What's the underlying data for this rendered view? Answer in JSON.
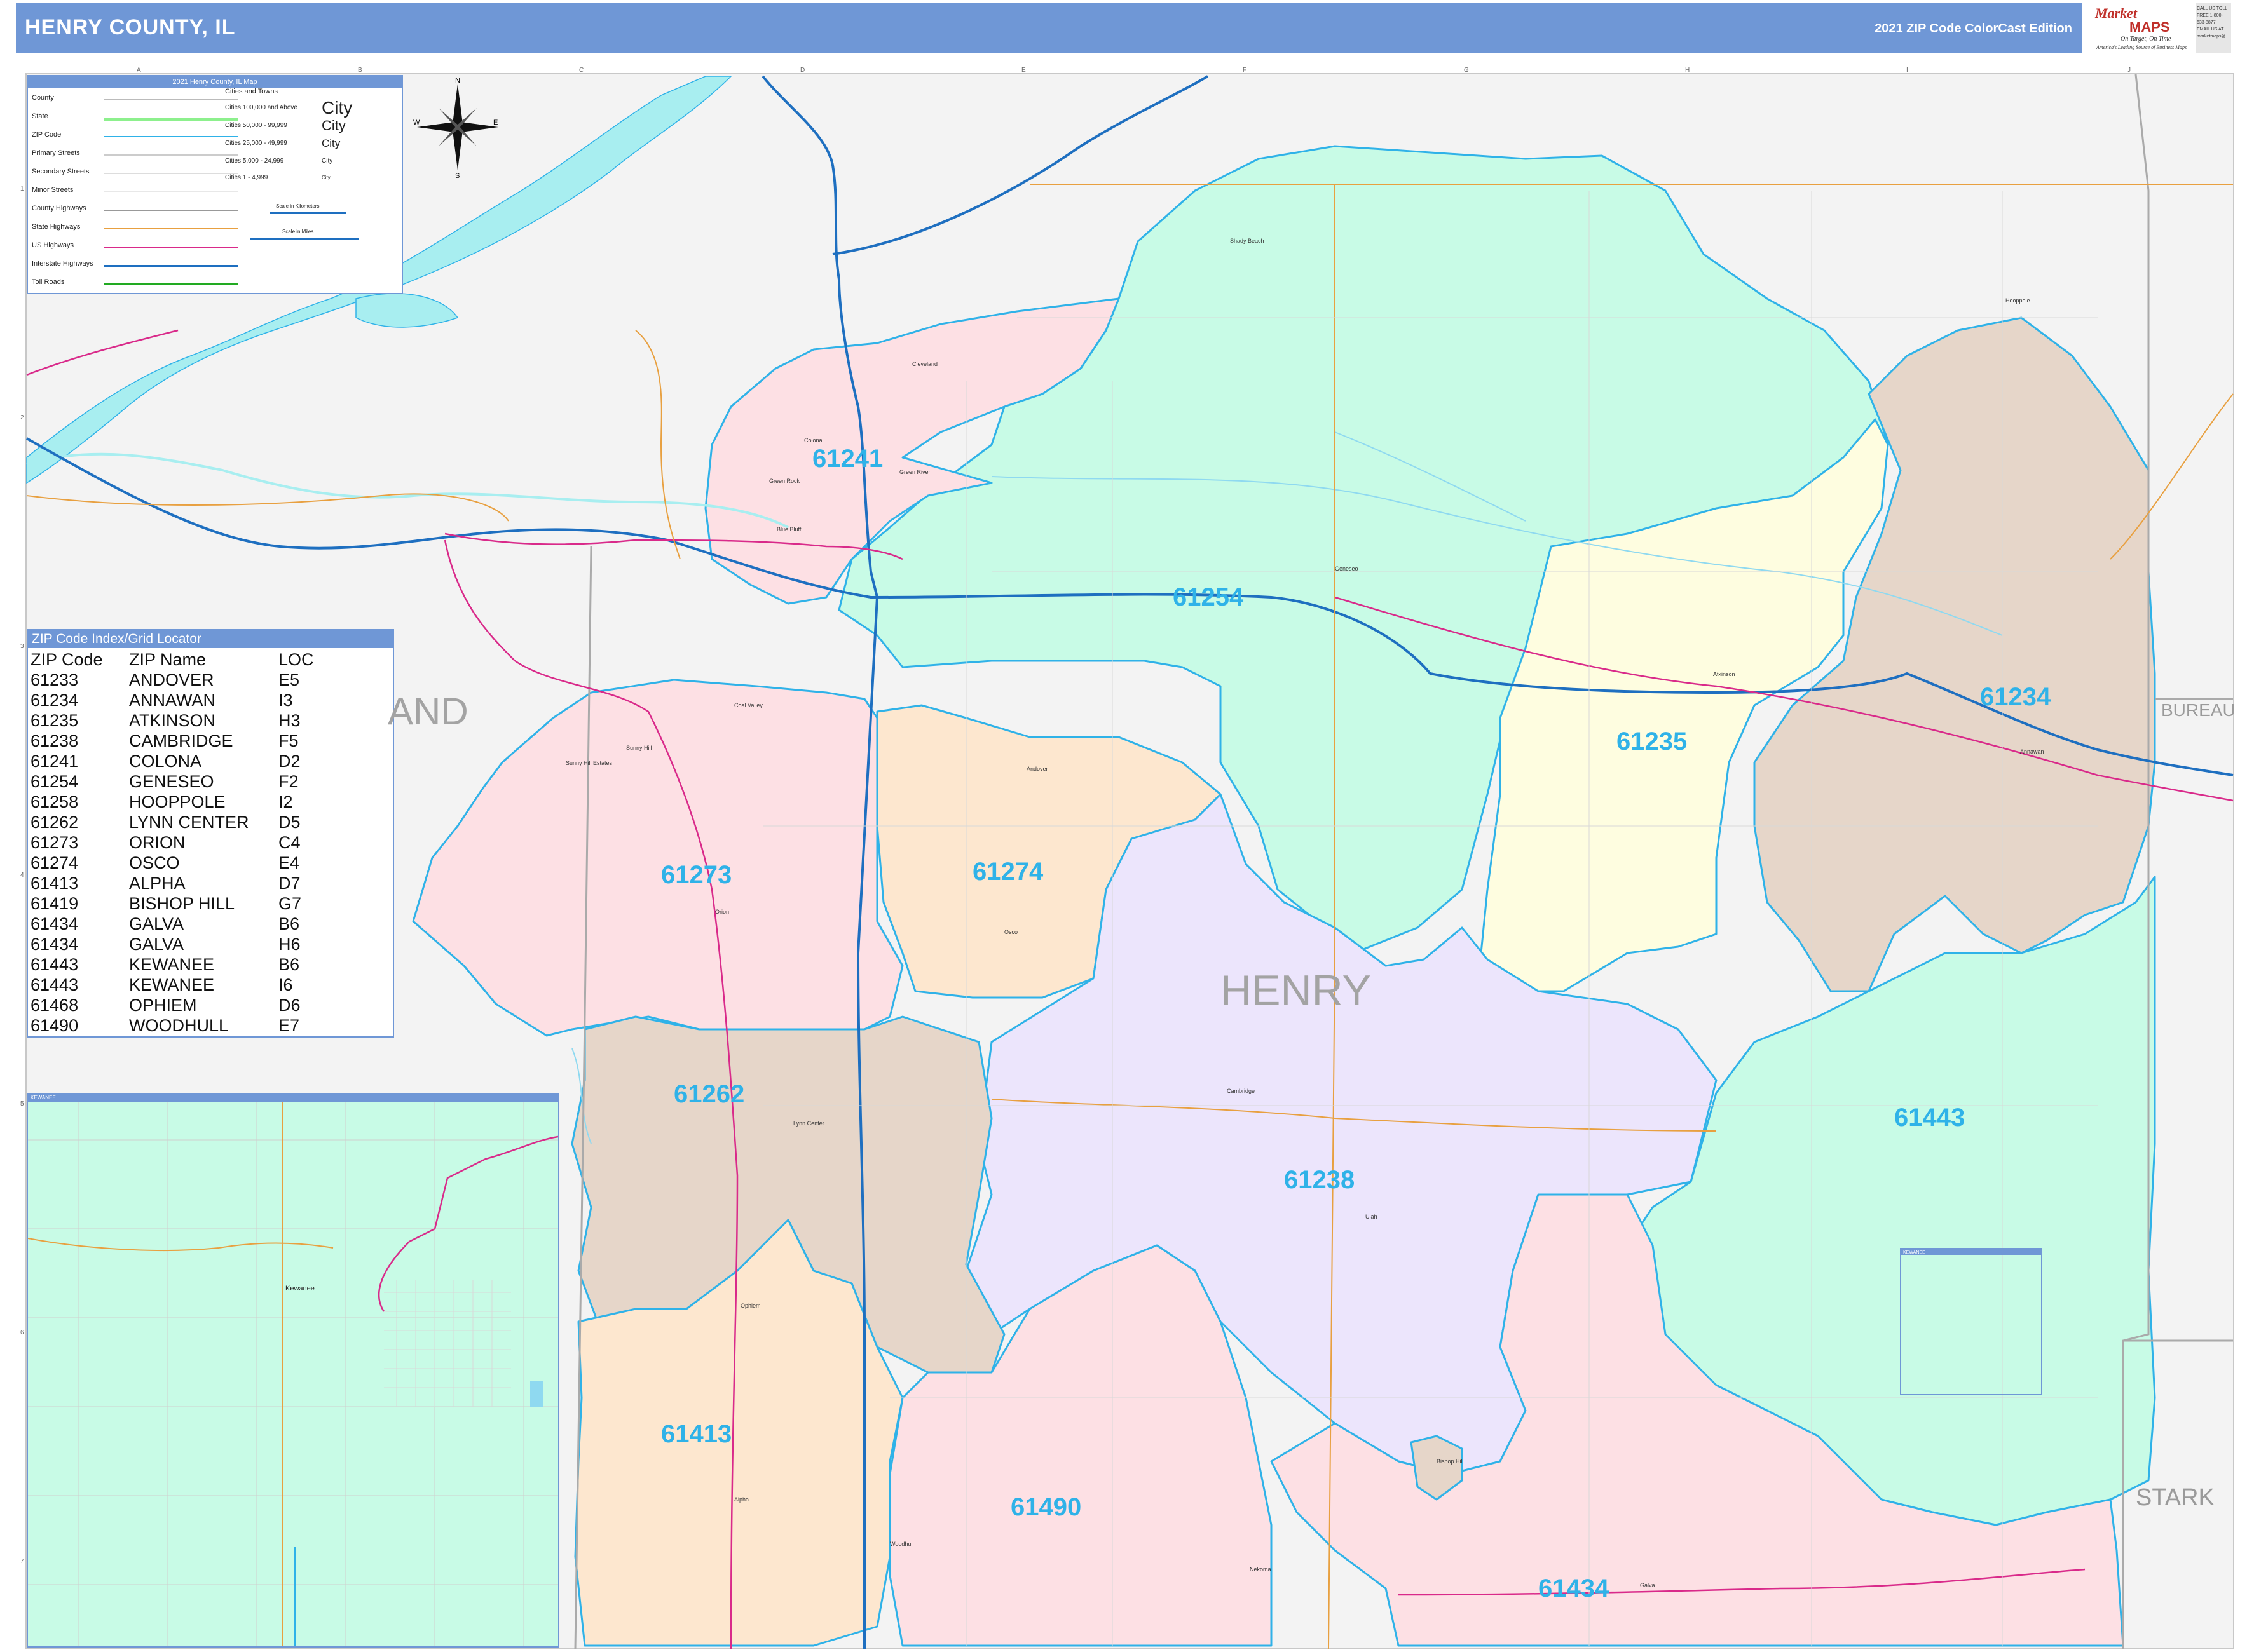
{
  "header": {
    "title": "HENRY COUNTY, IL",
    "edition": "2021 ZIP Code ColorCast Edition",
    "logo_brand": "Market",
    "logo_maps": "MAPS",
    "logo_tagline": "On Target, On Time",
    "logo_subtitle": "America's Leading Source of Business Maps",
    "logo_contact": "CALL US TOLL FREE 1-800-633-8877 EMAIL US AT marketmaps@..."
  },
  "legend": {
    "title": "2021 Henry County, IL Map",
    "line_items": [
      {
        "label": "County",
        "color": "#bbbbbb"
      },
      {
        "label": "State",
        "color": "#8df08d"
      },
      {
        "label": "ZIP Code",
        "color": "#2fb2e8"
      },
      {
        "label": "Primary Streets",
        "color": "#cccccc"
      },
      {
        "label": "Secondary Streets",
        "color": "#dddddd"
      },
      {
        "label": "Minor Streets",
        "color": "#e8e8e8"
      },
      {
        "label": "County Highways",
        "color": "#999999"
      },
      {
        "label": "State Highways",
        "color": "#e8a040"
      },
      {
        "label": "US Highways",
        "color": "#d92a8a"
      },
      {
        "label": "Interstate Highways",
        "color": "#1e6fc0"
      },
      {
        "label": "Toll Roads",
        "color": "#22aa22"
      }
    ],
    "cities_title": "Cities and Towns",
    "city_items": [
      {
        "label": "Cities 100,000 and Above",
        "sample": "City"
      },
      {
        "label": "Cities 50,000 - 99,999",
        "sample": "City"
      },
      {
        "label": "Cities 25,000 - 49,999",
        "sample": "City"
      },
      {
        "label": "Cities 5,000 - 24,999",
        "sample": "City"
      },
      {
        "label": "Cities 1 - 4,999",
        "sample": "City"
      }
    ],
    "scale_km": "Scale in Kilometers",
    "scale_mi": "Scale in Miles"
  },
  "compass": {
    "n": "N",
    "s": "S",
    "e": "E",
    "w": "W"
  },
  "zip_index": {
    "title": "ZIP Code Index/Grid Locator",
    "columns": [
      "ZIP Code",
      "ZIP Name",
      "LOC"
    ],
    "rows": [
      [
        "61233",
        "ANDOVER",
        "E5"
      ],
      [
        "61234",
        "ANNAWAN",
        "I3"
      ],
      [
        "61235",
        "ATKINSON",
        "H3"
      ],
      [
        "61238",
        "CAMBRIDGE",
        "F5"
      ],
      [
        "61241",
        "COLONA",
        "D2"
      ],
      [
        "61254",
        "GENESEO",
        "F2"
      ],
      [
        "61258",
        "HOOPPOLE",
        "I2"
      ],
      [
        "61262",
        "LYNN CENTER",
        "D5"
      ],
      [
        "61273",
        "ORION",
        "C4"
      ],
      [
        "61274",
        "OSCO",
        "E4"
      ],
      [
        "61413",
        "ALPHA",
        "D7"
      ],
      [
        "61419",
        "BISHOP HILL",
        "G7"
      ],
      [
        "61434",
        "GALVA",
        "B6"
      ],
      [
        "61434",
        "GALVA",
        "H6"
      ],
      [
        "61443",
        "KEWANEE",
        "B6"
      ],
      [
        "61443",
        "KEWANEE",
        "I6"
      ],
      [
        "61468",
        "OPHIEM",
        "D6"
      ],
      [
        "61490",
        "WOODHULL",
        "E7"
      ]
    ]
  },
  "inset": {
    "title": "KEWANEE",
    "town": "Kewanee"
  },
  "small_inset_title": "KEWANEE",
  "counties": {
    "main": "HENRY",
    "west_partial": "AND",
    "east": "BUREAU",
    "southeast": "STARK"
  },
  "zip_labels": [
    "61241",
    "61254",
    "61234",
    "61235",
    "61273",
    "61274",
    "61262",
    "61238",
    "61443",
    "61413",
    "61490",
    "61434"
  ],
  "towns": [
    "Cleveland",
    "Colona",
    "Green Rock",
    "Green River",
    "Shady Beach",
    "Hooppole",
    "Geneseo",
    "Atkinson",
    "Annawan",
    "Coal Valley",
    "Sunny Hill",
    "Sunny Hill Estates",
    "Orion",
    "Osco",
    "Ulah",
    "Cambridge",
    "Lynn Center",
    "Ophiem",
    "Alpha",
    "Woodhull",
    "Nekoma",
    "Bishop Hill",
    "Galva",
    "Andover",
    "Blue Bluff"
  ],
  "grid": {
    "cols": [
      "A",
      "B",
      "C",
      "D",
      "E",
      "F",
      "G",
      "H",
      "I",
      "J"
    ],
    "rows": [
      "1",
      "2",
      "3",
      "4",
      "5",
      "6",
      "7"
    ]
  },
  "colors": {
    "header": "#6f97d6",
    "mint": "#c8fbe6",
    "pink": "#fde0e4",
    "peach": "#fde7cf",
    "tan": "#e6d6c9",
    "lavender": "#ece5fc",
    "yellow": "#fefde0",
    "zip_border": "#2fb2e8",
    "river": "#a8eef0",
    "zip_label": "#2fb2e8"
  }
}
